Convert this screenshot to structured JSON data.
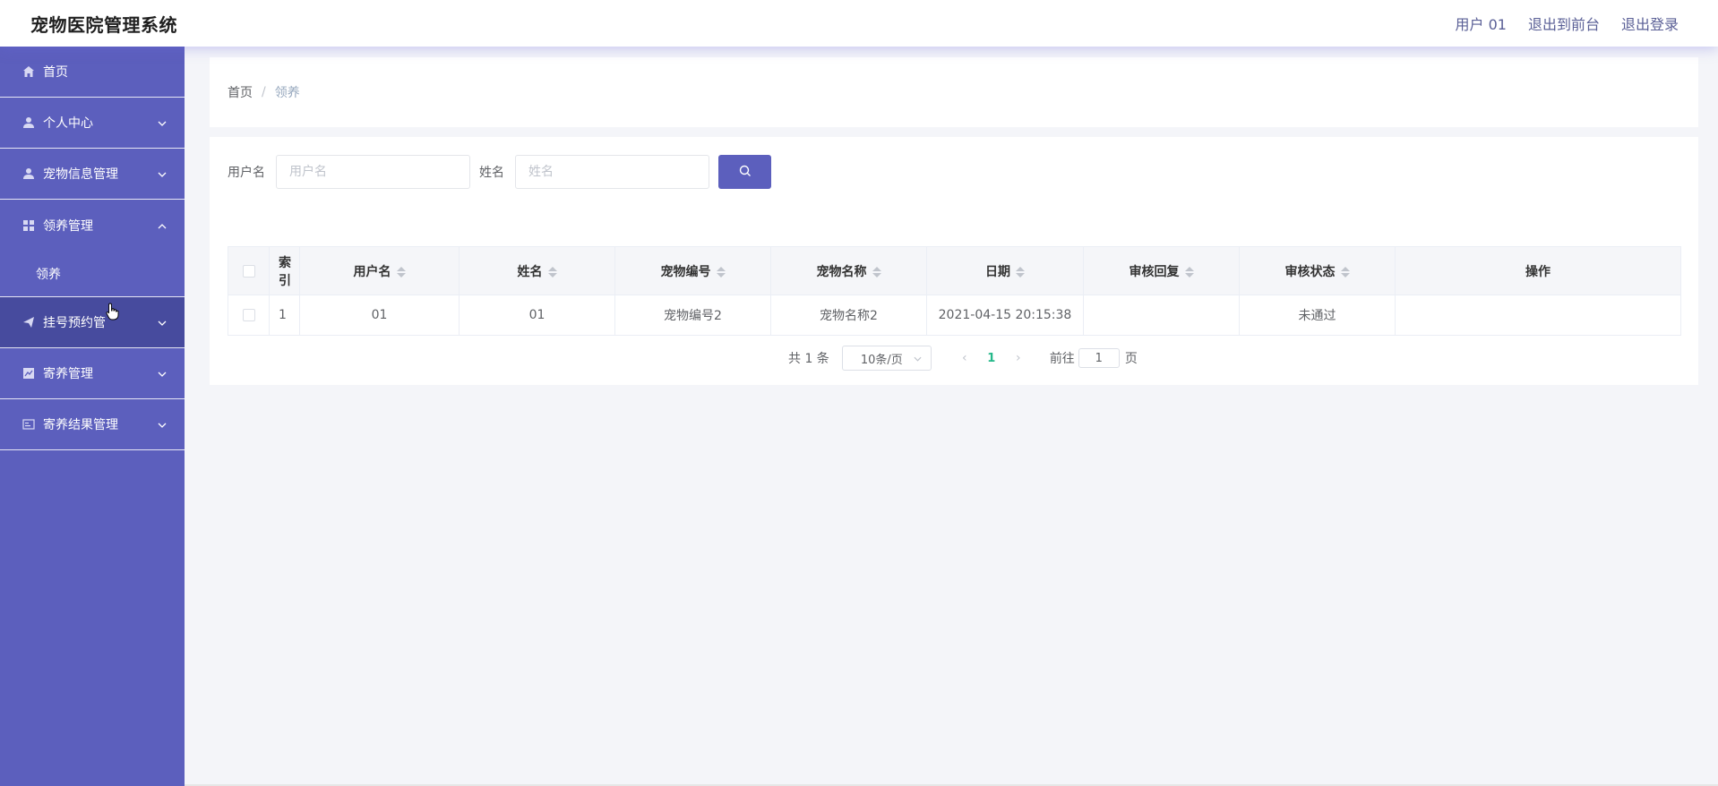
{
  "header": {
    "title": "宠物医院管理系统",
    "user": "用户 01",
    "back_front": "退出到前台",
    "logout": "退出登录"
  },
  "sidebar": {
    "items": [
      {
        "label": "首页",
        "icon": "home-icon"
      },
      {
        "label": "个人中心",
        "icon": "user-icon"
      },
      {
        "label": "宠物信息管理",
        "icon": "user-icon"
      },
      {
        "label": "领养管理",
        "icon": "grid-icon",
        "expanded": true,
        "children": [
          {
            "label": "领养"
          }
        ]
      },
      {
        "label": "挂号预约管",
        "icon": "send-icon",
        "active": true
      },
      {
        "label": "寄养管理",
        "icon": "chart-icon"
      },
      {
        "label": "寄养结果管理",
        "icon": "card-icon"
      }
    ]
  },
  "breadcrumb": {
    "home": "首页",
    "separator": "/",
    "current": "领养"
  },
  "search": {
    "username_label": "用户名",
    "username_placeholder": "用户名",
    "name_label": "姓名",
    "name_placeholder": "姓名"
  },
  "table": {
    "headers": [
      "索引",
      "用户名",
      "姓名",
      "宠物编号",
      "宠物名称",
      "日期",
      "审核回复",
      "审核状态",
      "操作"
    ],
    "rows": [
      {
        "index": "1",
        "username": "01",
        "name": "01",
        "pet_no": "宠物编号2",
        "pet_name": "宠物名称2",
        "date": "2021-04-15 20:15:38",
        "reply": "",
        "status": "未通过",
        "actions": ""
      }
    ]
  },
  "pagination": {
    "total": "共 1 条",
    "page_size": "10条/页",
    "prev": "‹",
    "current_page": "1",
    "next": "›",
    "goto_label": "前往",
    "goto_value": "1",
    "page_suffix": "页"
  },
  "colors": {
    "sidebar_bg": "#5c5fbd",
    "sidebar_active": "#474b9e",
    "accent": "#5c5fbd",
    "page_active": "#25b88a"
  }
}
